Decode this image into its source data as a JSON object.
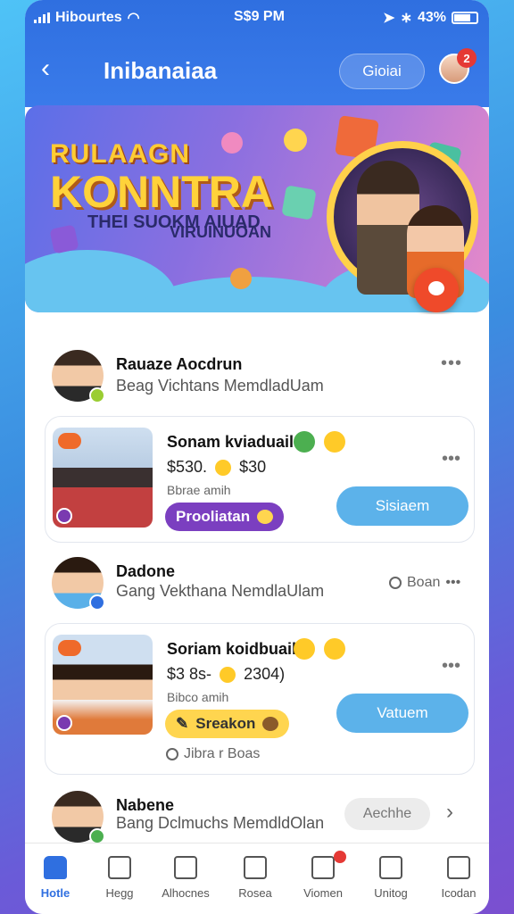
{
  "status_bar": {
    "carrier": "Hibourtes",
    "time": "S$9 PM",
    "battery": "43%"
  },
  "header": {
    "title": "Inibanaiaa",
    "global_button": "Gioiai",
    "notification_count": "2"
  },
  "banner": {
    "line1": "RULAAGN",
    "line2": "KONNTRA",
    "line3": "THEI SUOKM AIUAD",
    "line4": "VIRUINUOAN"
  },
  "items": [
    {
      "name": "Rauaze Aocdrun",
      "subtitle": "Beag Vichtans MemdladUam"
    },
    {
      "name": "Dadone",
      "subtitle": "Gang Vekthana NemdlaUlam",
      "status": "Boan"
    },
    {
      "name": "Nabene",
      "subtitle": "Bang Dclmuchs MemdldOlan",
      "action": "Aechhe"
    }
  ],
  "cards": [
    {
      "title": "Sonam kviaduail",
      "price": "$530.",
      "price2": "$30",
      "sub": "Bbrae amih",
      "tag": "Prooliatan",
      "action": "Sisiaem",
      "tag_color": "#7b3fc0"
    },
    {
      "title": "Soriam koidbuail",
      "price": "$3 8s-",
      "price2": "2304)",
      "sub": "Bibco amih",
      "tag": "Sreakon",
      "action": "Vatuem",
      "tag_color": "#ffd54f"
    }
  ],
  "bottom_meta": "Jibra r Boas",
  "tabs": [
    {
      "label": "Hotle",
      "icon": "home-icon"
    },
    {
      "label": "Hegg",
      "icon": "house-outline-icon"
    },
    {
      "label": "Alhocnes",
      "icon": "grid-icon"
    },
    {
      "label": "Rosea",
      "icon": "bolt-icon"
    },
    {
      "label": "Viomen",
      "icon": "chat-icon"
    },
    {
      "label": "Unitog",
      "icon": "bag-icon"
    },
    {
      "label": "Icodan",
      "icon": "menu-icon"
    }
  ],
  "colors": {
    "primary": "#2f6fe0",
    "accent": "#5cb2ea",
    "badge": "#e53935"
  }
}
